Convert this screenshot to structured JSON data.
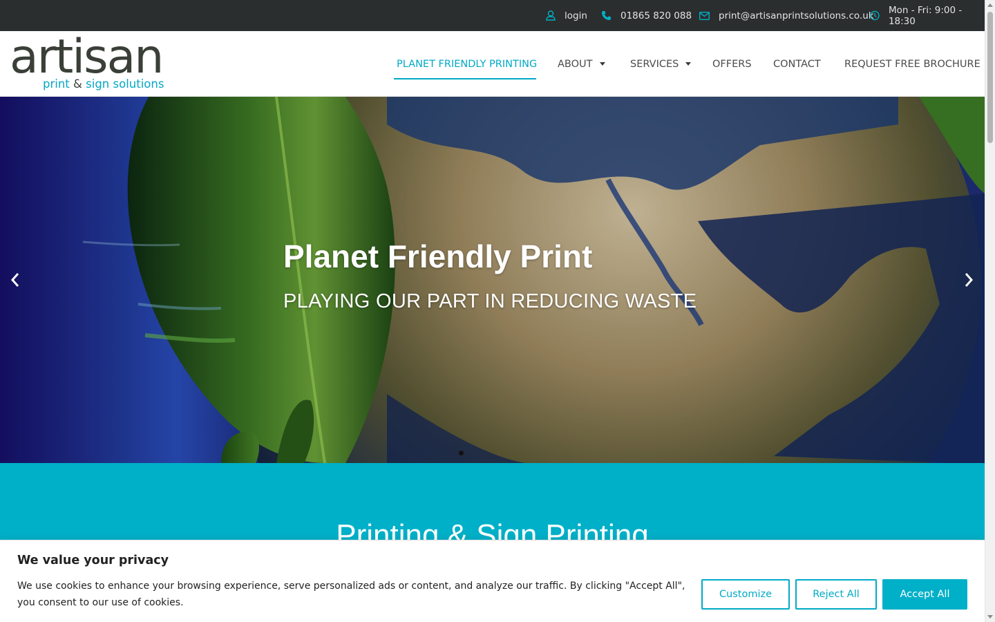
{
  "topbar": {
    "login": "login",
    "phone": "01865 820 088",
    "email": "print@artisanprintsolutions.co.uk",
    "hours": "Mon - Fri: 9:00 - 18:30"
  },
  "logo": {
    "main": "artisan",
    "sub_print": "print",
    "sub_amp": "&",
    "sub_rest": "sign solutions"
  },
  "nav": {
    "items": [
      {
        "label": "PLANET FRIENDLY PRINTING",
        "active": true,
        "dropdown": false
      },
      {
        "label": "ABOUT",
        "active": false,
        "dropdown": true
      },
      {
        "label": "SERVICES",
        "active": false,
        "dropdown": true
      },
      {
        "label": "OFFERS",
        "active": false,
        "dropdown": false
      },
      {
        "label": "CONTACT",
        "active": false,
        "dropdown": false
      },
      {
        "label": "REQUEST FREE BROCHURE",
        "active": false,
        "dropdown": false
      }
    ]
  },
  "hero": {
    "title": "Planet Friendly Print",
    "subtitle": "PLAYING OUR PART IN REDUCING WASTE",
    "prev_icon": "chevron-left-icon",
    "next_icon": "chevron-right-icon"
  },
  "section": {
    "title": "Printing & Sign Printing"
  },
  "cookie": {
    "title": "We value your privacy",
    "text": "We use cookies to enhance your browsing experience, serve personalized ads or content, and analyze our traffic. By clicking \"Accept All\", you consent to our use of cookies.",
    "customize": "Customize",
    "reject": "Reject All",
    "accept": "Accept All"
  },
  "colors": {
    "accent": "#00a9c6",
    "topbar_bg": "#2b2e2e",
    "teal_section": "#00b0c8",
    "logo_dark": "#3a4038"
  }
}
